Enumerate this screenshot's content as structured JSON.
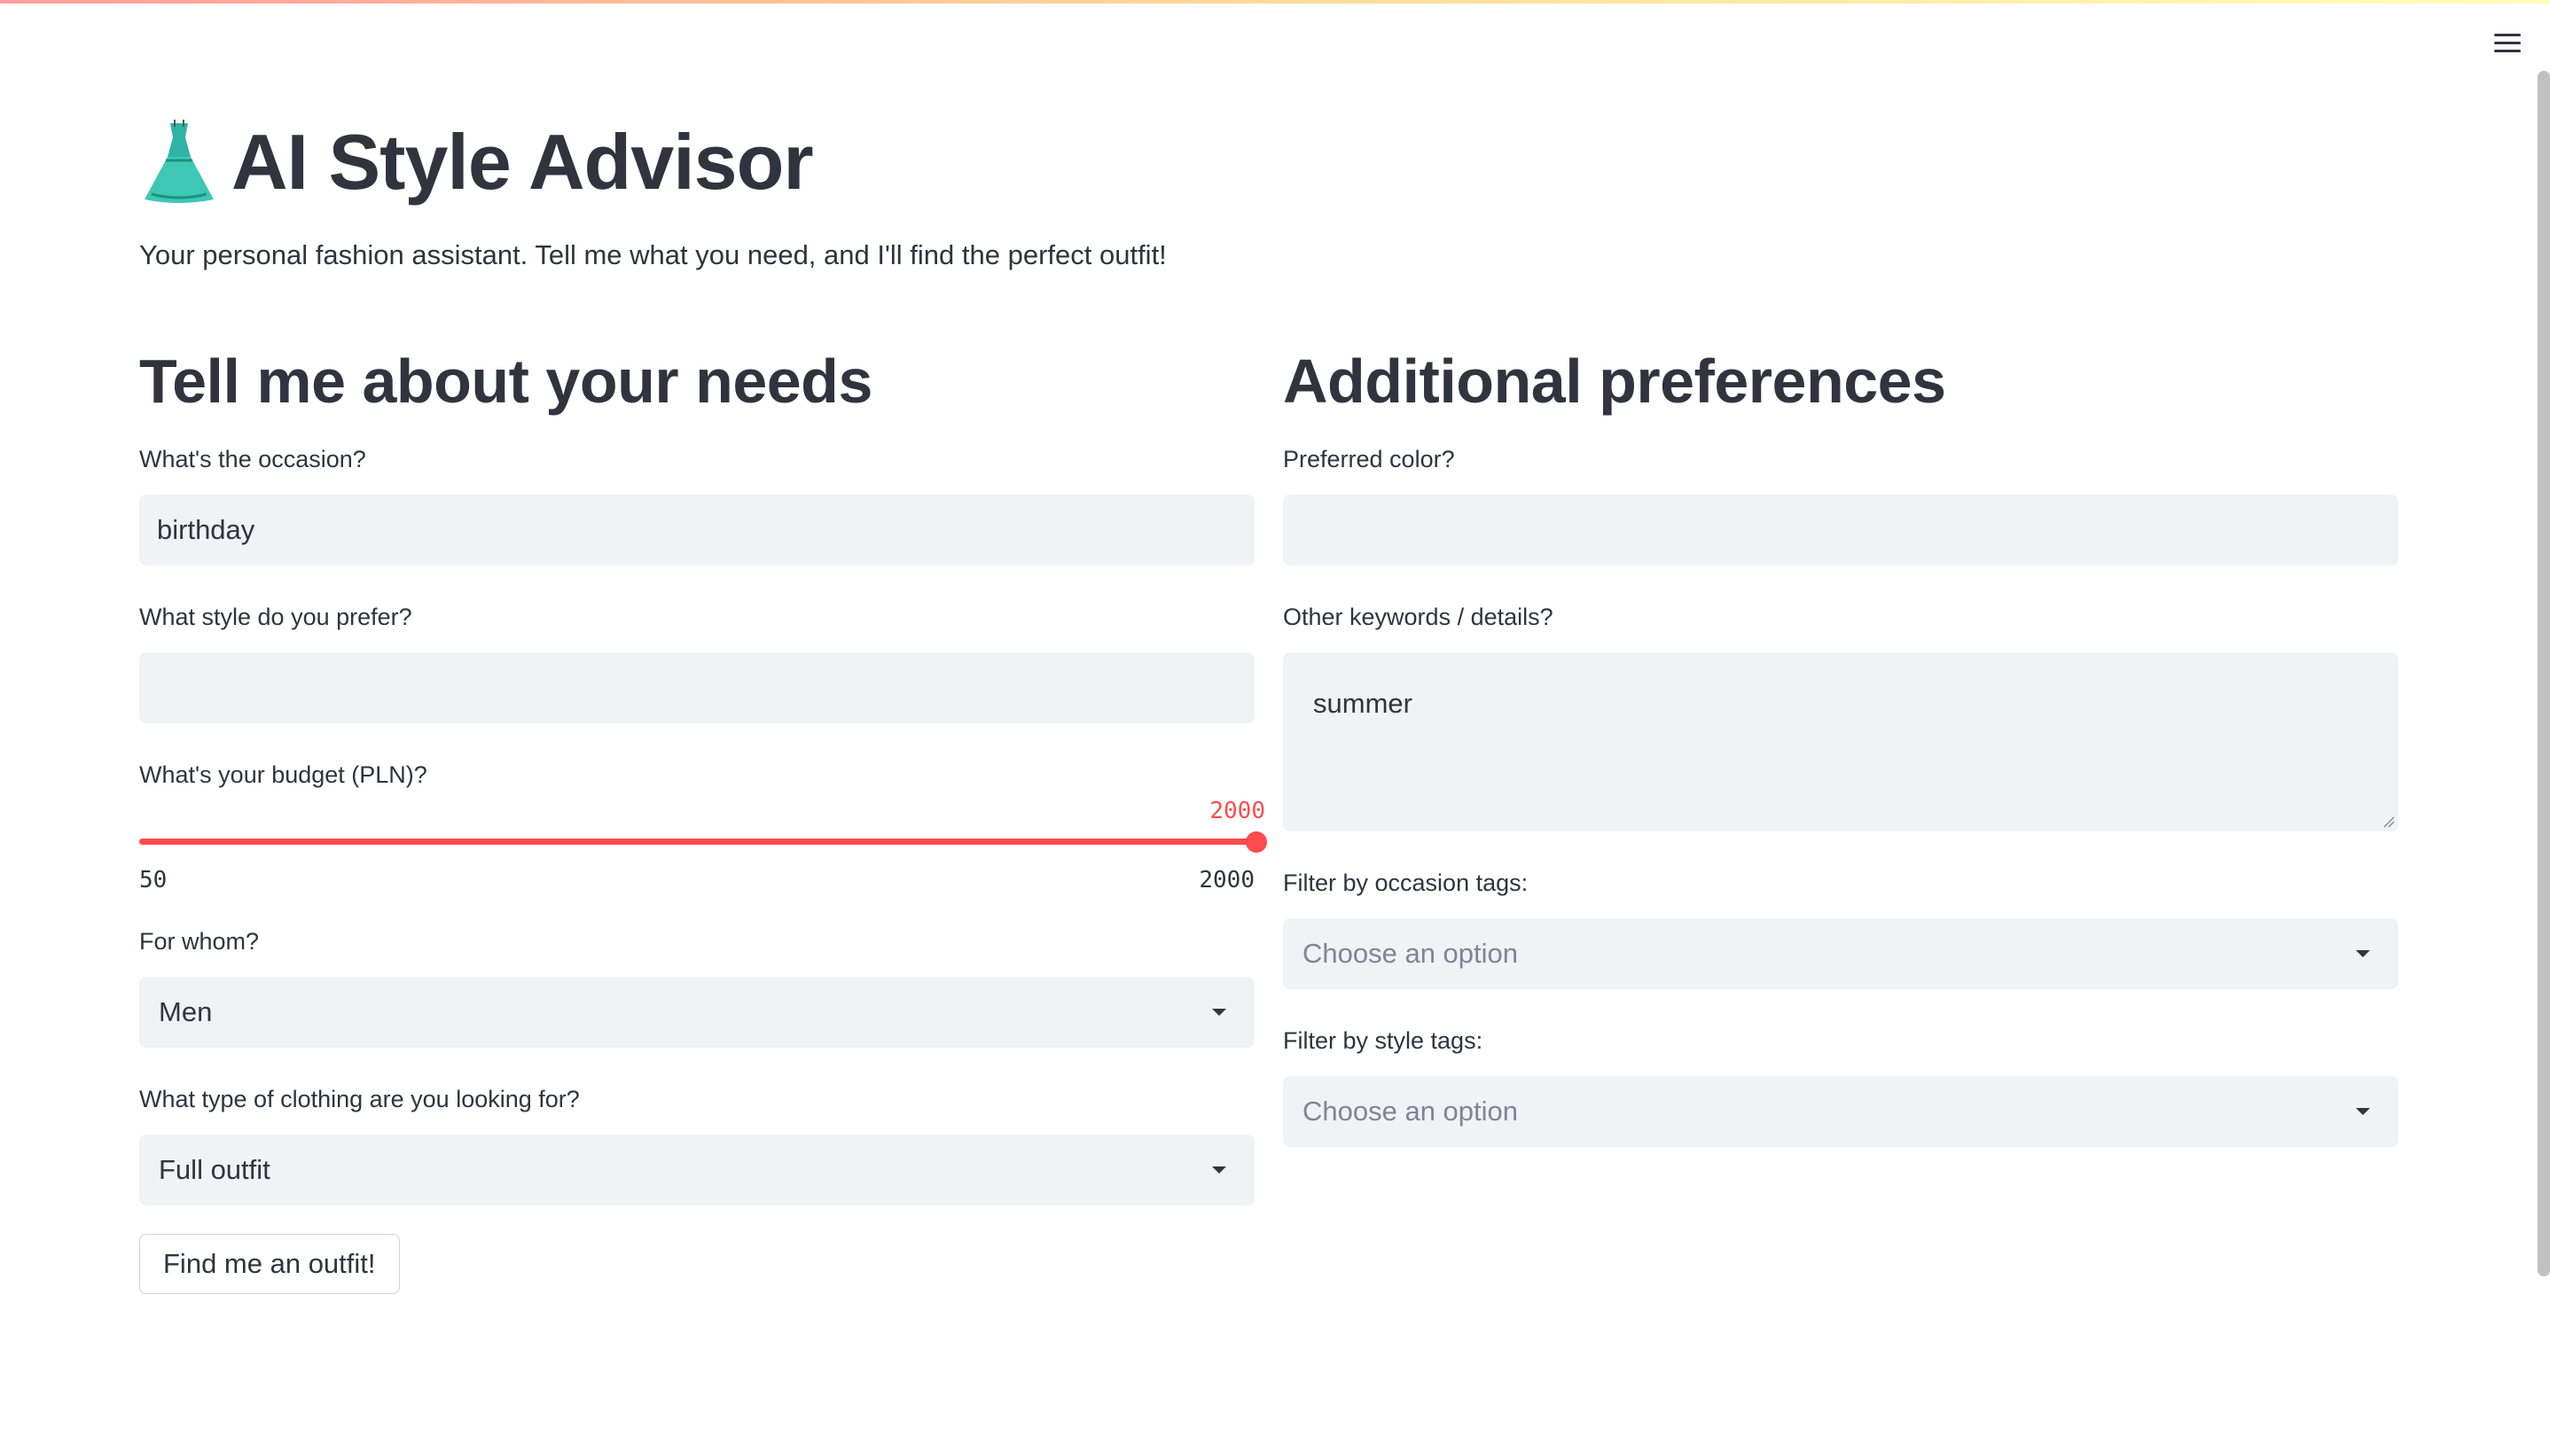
{
  "app": {
    "title": "AI Style Advisor",
    "subtitle": "Your personal fashion assistant. Tell me what you need, and I'll find the perfect outfit!",
    "title_icon": "dress-icon",
    "menu_icon": "hamburger-menu-icon"
  },
  "left": {
    "heading": "Tell me about your needs",
    "occasion": {
      "label": "What's the occasion?",
      "value": "birthday"
    },
    "style": {
      "label": "What style do you prefer?",
      "value": ""
    },
    "budget": {
      "label": "What's your budget (PLN)?",
      "value": "2000",
      "min": "50",
      "max": "2000",
      "fill_fraction": 1.0,
      "accent_color": "#ff4b4b"
    },
    "for_whom": {
      "label": "For whom?",
      "value": "Men"
    },
    "clothing_type": {
      "label": "What type of clothing are you looking for?",
      "value": "Full outfit"
    },
    "submit_label": "Find me an outfit!"
  },
  "right": {
    "heading": "Additional preferences",
    "color": {
      "label": "Preferred color?",
      "value": ""
    },
    "keywords": {
      "label": "Other keywords / details?",
      "value": "summer"
    },
    "occasion_tags": {
      "label": "Filter by occasion tags:",
      "placeholder": "Choose an option"
    },
    "style_tags": {
      "label": "Filter by style tags:",
      "placeholder": "Choose an option"
    }
  }
}
